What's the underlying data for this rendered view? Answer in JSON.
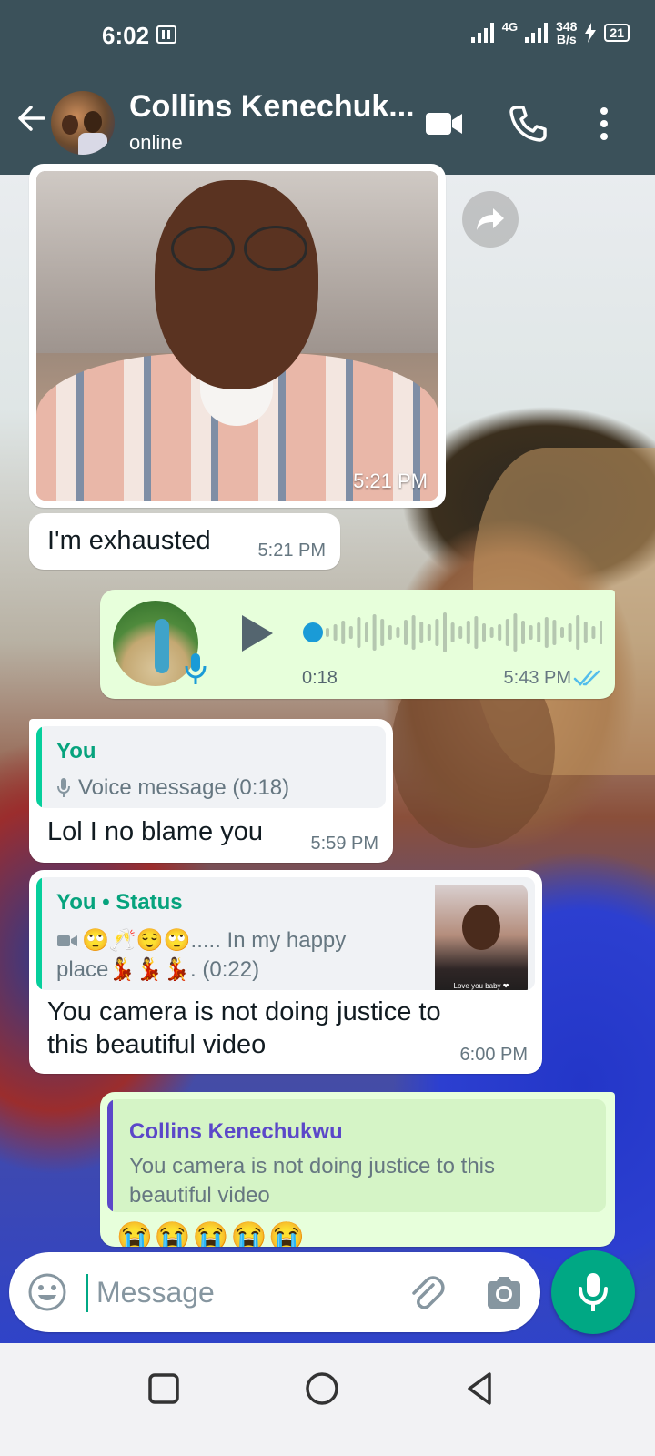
{
  "status_bar": {
    "time": "6:02",
    "network": "4G",
    "speed_value": "348",
    "speed_unit": "B/s",
    "battery": "21"
  },
  "header": {
    "contact_name": "Collins Kenechuk...",
    "contact_status": "online"
  },
  "messages": [
    {
      "type": "image",
      "direction": "incoming",
      "time": "5:21 PM"
    },
    {
      "type": "text",
      "direction": "incoming",
      "text": "I'm exhausted",
      "time": "5:21 PM"
    },
    {
      "type": "voice",
      "direction": "outgoing",
      "duration": "0:18",
      "time": "5:43 PM",
      "status": "read"
    },
    {
      "type": "reply",
      "direction": "incoming",
      "quote_author": "You",
      "quote_text": "Voice message (0:18)",
      "text": "Lol I no blame you",
      "time": "5:59 PM"
    },
    {
      "type": "status_reply",
      "direction": "incoming",
      "quote_author": "You • Status",
      "quote_text_line1": "🙄🥂😌🙄..... In my happy",
      "quote_text_line2": "place💃💃💃. (0:22)",
      "thumb_caption": "Love you baby ❤",
      "text_line1": "You camera is not doing justice to",
      "text_line2": "this beautiful video",
      "time": "6:00 PM"
    },
    {
      "type": "reply",
      "direction": "outgoing",
      "quote_author": "Collins Kenechukwu",
      "quote_text_line1": "You camera is not doing justice to this",
      "quote_text_line2": "beautiful video",
      "text": "😭😭😭😭😭"
    }
  ],
  "input": {
    "placeholder": "Message"
  },
  "colors": {
    "header": "#3b515a",
    "accent": "#00a884",
    "outgoing_bubble": "#e7ffdb",
    "incoming_bubble": "#ffffff",
    "read_ticks": "#53bdeb",
    "quote_bar_you": "#06cf9c",
    "quote_bar_contact": "#5b47c9"
  },
  "icons": [
    "back-arrow-icon",
    "video-call-icon",
    "phone-icon",
    "more-vert-icon",
    "forward-icon",
    "play-icon",
    "mic-icon",
    "emoji-icon",
    "attach-icon",
    "camera-icon",
    "square-nav-icon",
    "circle-nav-icon",
    "triangle-nav-icon"
  ]
}
